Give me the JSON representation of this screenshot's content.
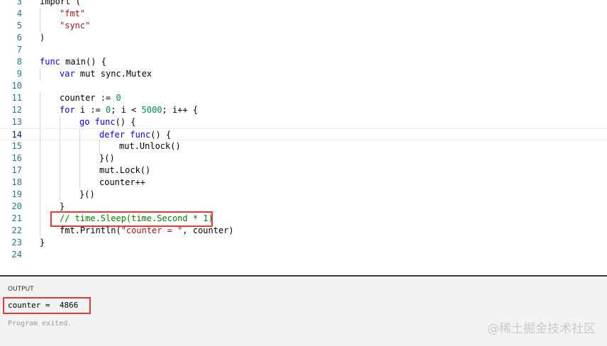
{
  "editor": {
    "lines": [
      {
        "n": "3",
        "indent": 0,
        "tokens": [
          {
            "t": "import (",
            "c": "plain"
          }
        ]
      },
      {
        "n": "4",
        "indent": 1,
        "tokens": [
          {
            "t": "\"fmt\"",
            "c": "str"
          }
        ]
      },
      {
        "n": "5",
        "indent": 1,
        "tokens": [
          {
            "t": "\"sync\"",
            "c": "str"
          }
        ]
      },
      {
        "n": "6",
        "indent": 0,
        "tokens": [
          {
            "t": ")",
            "c": "plain"
          }
        ]
      },
      {
        "n": "7",
        "indent": 0,
        "tokens": []
      },
      {
        "n": "8",
        "indent": 0,
        "tokens": [
          {
            "t": "func",
            "c": "kw"
          },
          {
            "t": " main() {",
            "c": "plain"
          }
        ]
      },
      {
        "n": "9",
        "indent": 1,
        "tokens": [
          {
            "t": "var",
            "c": "kw"
          },
          {
            "t": " mut sync.Mutex",
            "c": "plain"
          }
        ]
      },
      {
        "n": "10",
        "indent": 0,
        "tokens": []
      },
      {
        "n": "11",
        "indent": 1,
        "tokens": [
          {
            "t": "counter := ",
            "c": "plain"
          },
          {
            "t": "0",
            "c": "num"
          }
        ]
      },
      {
        "n": "12",
        "indent": 1,
        "tokens": [
          {
            "t": "for",
            "c": "kw"
          },
          {
            "t": " i := ",
            "c": "plain"
          },
          {
            "t": "0",
            "c": "num"
          },
          {
            "t": "; i < ",
            "c": "plain"
          },
          {
            "t": "5000",
            "c": "num"
          },
          {
            "t": "; i++ {",
            "c": "plain"
          }
        ]
      },
      {
        "n": "13",
        "indent": 2,
        "tokens": [
          {
            "t": "go",
            "c": "kw"
          },
          {
            "t": " ",
            "c": "plain"
          },
          {
            "t": "func",
            "c": "kw"
          },
          {
            "t": "() {",
            "c": "plain"
          }
        ]
      },
      {
        "n": "14",
        "indent": 3,
        "current": true,
        "tokens": [
          {
            "t": "defer",
            "c": "kw"
          },
          {
            "t": " ",
            "c": "plain"
          },
          {
            "t": "func",
            "c": "kw"
          },
          {
            "t": "() {",
            "c": "plain"
          }
        ]
      },
      {
        "n": "15",
        "indent": 4,
        "tokens": [
          {
            "t": "mut.Unlock()",
            "c": "plain"
          }
        ]
      },
      {
        "n": "16",
        "indent": 3,
        "tokens": [
          {
            "t": "}()",
            "c": "plain"
          }
        ]
      },
      {
        "n": "17",
        "indent": 3,
        "tokens": [
          {
            "t": "mut.Lock()",
            "c": "plain"
          }
        ]
      },
      {
        "n": "18",
        "indent": 3,
        "tokens": [
          {
            "t": "counter++",
            "c": "plain"
          }
        ]
      },
      {
        "n": "19",
        "indent": 2,
        "tokens": [
          {
            "t": "}()",
            "c": "plain"
          }
        ]
      },
      {
        "n": "20",
        "indent": 1,
        "tokens": [
          {
            "t": "}",
            "c": "plain"
          }
        ]
      },
      {
        "n": "21",
        "indent": 1,
        "tokens": [
          {
            "t": "// time.Sleep(time.Second * 1)",
            "c": "com"
          }
        ]
      },
      {
        "n": "22",
        "indent": 1,
        "tokens": [
          {
            "t": "fmt.Println(",
            "c": "plain"
          },
          {
            "t": "\"counter = \"",
            "c": "str"
          },
          {
            "t": ", counter)",
            "c": "plain"
          }
        ]
      },
      {
        "n": "23",
        "indent": 0,
        "tokens": [
          {
            "t": "}",
            "c": "plain"
          }
        ]
      },
      {
        "n": "24",
        "indent": 0,
        "tokens": []
      }
    ]
  },
  "output": {
    "title": "OUTPUT",
    "result": "counter =  4866",
    "status": "Program exited."
  },
  "watermark": "@稀土掘金技术社区",
  "colors": {
    "keyword": "#0000ff",
    "string": "#a31515",
    "number": "#098658",
    "comment": "#008000",
    "line_number": "#237893",
    "highlight_box": "#e53935"
  }
}
